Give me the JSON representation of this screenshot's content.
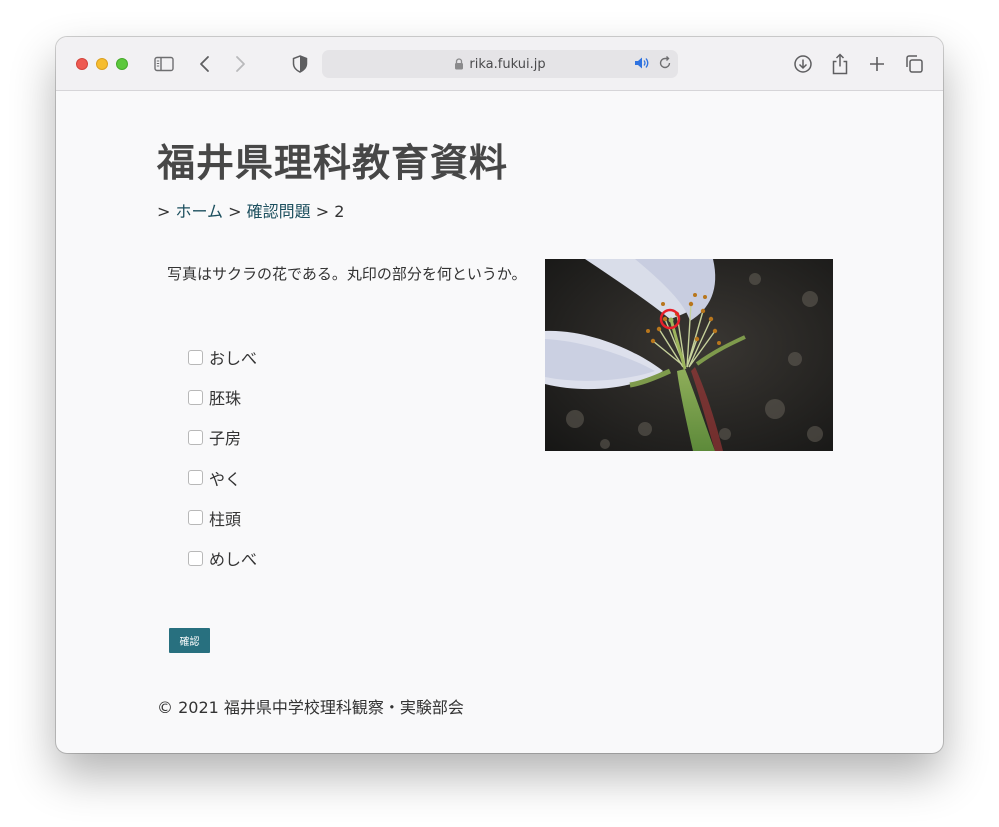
{
  "browser": {
    "url": "rika.fukui.jp",
    "icons": [
      "sidebar-icon",
      "back-icon",
      "forward-icon",
      "shield-icon",
      "lock-icon",
      "speaker-icon",
      "reload-icon",
      "download-icon",
      "share-icon",
      "new-tab-icon",
      "tabs-overview-icon"
    ]
  },
  "page": {
    "site_title": "福井県理科教育資料",
    "breadcrumb": {
      "sep1": "> ",
      "home": "ホーム",
      "sep2": " > ",
      "section": "確認問題",
      "sep3": " > ",
      "current": "2"
    },
    "question": "写真はサクラの花である。丸印の部分を何というか。",
    "options": [
      "おしべ",
      "胚珠",
      "子房",
      "やく",
      "柱頭",
      "めしべ"
    ],
    "confirm_label": "確認",
    "footer": "© 2021 福井県中学校理科観察・実験部会"
  },
  "colors": {
    "link": "#1c4f5e",
    "button": "#28707f",
    "title": "#474747",
    "highlight_circle": "#e8202a"
  }
}
